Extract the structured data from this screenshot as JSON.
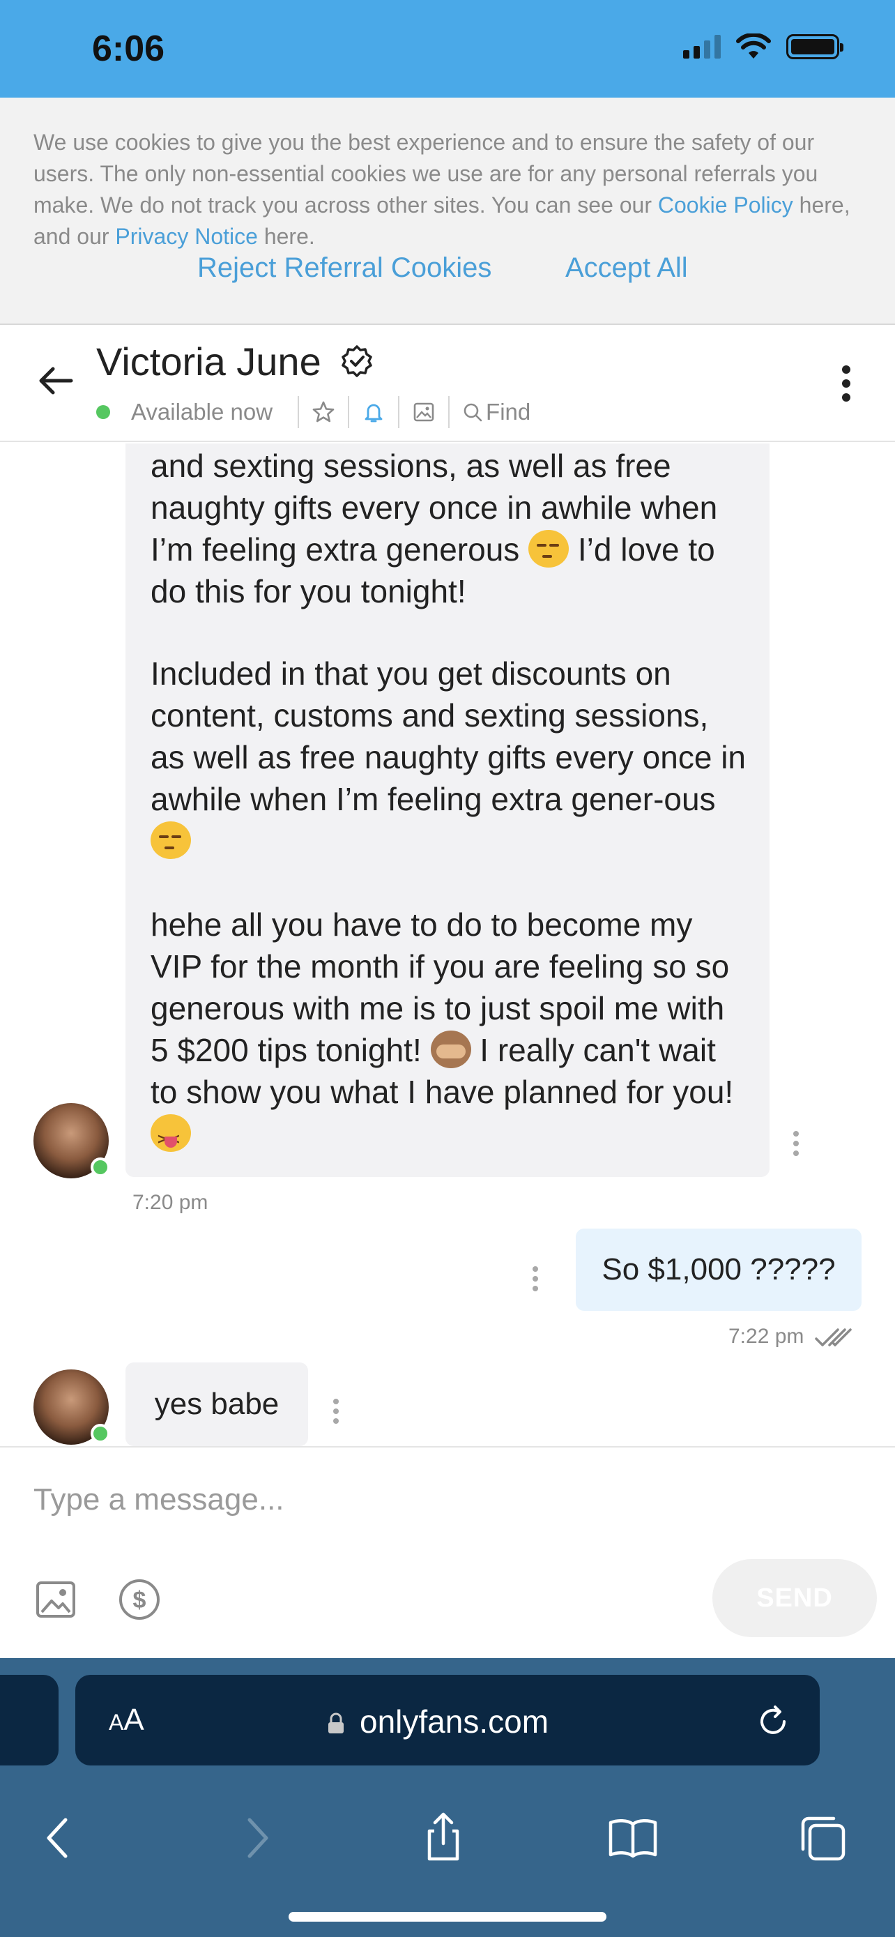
{
  "status_bar": {
    "time": "6:06"
  },
  "cookie_banner": {
    "text_1": "We use cookies to give you the best experience and to ensure the safety of our users. The only non-essential cookies we use are for any personal referrals you make. We do not track you across other sites. You can see our ",
    "cookie_policy_link": "Cookie Policy",
    "text_2": " here, and our ",
    "privacy_link": "Privacy Notice",
    "text_3": " here.",
    "reject_label": "Reject Referral Cookies",
    "accept_label": "Accept All"
  },
  "chat_header": {
    "name": "Victoria June",
    "availability": "Available now",
    "find_label": "Find"
  },
  "messages": {
    "incoming_1": {
      "para_1_a": "and sexting sessions, as well as free naughty gifts every once in awhile when I’m feeling extra generous ",
      "para_1_b": " I’d love to do this for you tonight!",
      "para_2_a": "Included in that you get discounts on content, customs and sexting sessions, as well as free naughty gifts every once in awhile when I’m feeling extra gener-ous ",
      "para_3_a": "hehe all you have to do to become my VIP for the month if you are feeling so so generous with me is to just spoil me with 5 $200 tips tonight! ",
      "para_3_b": " I really can't wait to show you what I have planned for you! ",
      "time": "7:20 pm"
    },
    "outgoing_1": {
      "text": "So $1,000 ?????",
      "time": "7:22 pm"
    },
    "incoming_2": {
      "text": "yes babe"
    }
  },
  "composer": {
    "placeholder": "Type a message...",
    "send_label": "SEND"
  },
  "browser": {
    "aa_big": "A",
    "aa_small": "A",
    "url": "onlyfans.com"
  },
  "colors": {
    "status_bar_bg": "#4aa9e8",
    "link_blue": "#4a9fd8",
    "online_green": "#55c760",
    "outgoing_bubble": "#e7f3fd",
    "incoming_bubble": "#f2f2f4",
    "browser_bg": "#36658b",
    "url_bar_bg": "#0b2742"
  },
  "icons": [
    "signal-icon",
    "wifi-icon",
    "battery-icon",
    "back-arrow-icon",
    "verified-badge-icon",
    "star-icon",
    "bell-icon",
    "image-icon",
    "search-icon",
    "more-vertical-icon",
    "image-attach-icon",
    "dollar-icon",
    "lock-icon",
    "reload-icon",
    "chevron-left-icon",
    "chevron-right-icon",
    "share-icon",
    "book-icon",
    "tabs-icon"
  ]
}
